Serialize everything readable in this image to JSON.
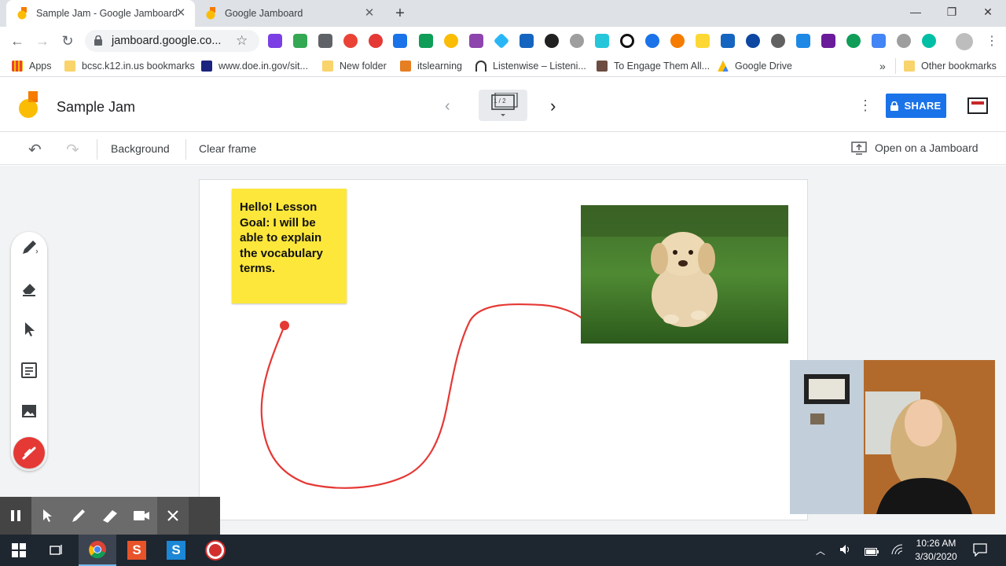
{
  "browser": {
    "tabs": [
      {
        "title": "Sample Jam - Google Jamboard",
        "active": true
      },
      {
        "title": "Google Jamboard",
        "active": false
      }
    ],
    "url": "jamboard.google.co...",
    "bookmarks": [
      {
        "label": "Apps",
        "icon": "apps-grid-icon"
      },
      {
        "label": "bcsc.k12.in.us bookmarks",
        "icon": "folder-icon"
      },
      {
        "label": "www.doe.in.gov/sit...",
        "icon": "doe-icon"
      },
      {
        "label": "New folder",
        "icon": "folder-icon"
      },
      {
        "label": "itslearning",
        "icon": "itslearning-icon"
      },
      {
        "label": "Listenwise – Listeni...",
        "icon": "headphones-icon"
      },
      {
        "label": "To Engage Them All...",
        "icon": "bookmark-thumbnail-icon"
      },
      {
        "label": "Google Drive",
        "icon": "google-drive-icon"
      }
    ],
    "other_bookmarks": "Other bookmarks",
    "more_bookmarks": "»"
  },
  "jamboard": {
    "title": "Sample Jam",
    "frame_indicator": "1 / 2",
    "share_label": "SHARE",
    "toolbar": {
      "background_label": "Background",
      "clear_frame_label": "Clear frame",
      "open_on_jamboard_label": "Open on a Jamboard"
    },
    "sticky_note": {
      "text": "Hello! Lesson Goal: I will be able to explain the vocabulary terms.",
      "color": "#fde73a"
    },
    "laser_color": "#e53935",
    "accent": "#1a73e8"
  },
  "taskbar": {
    "time": "10:26 AM",
    "date": "3/30/2020"
  }
}
